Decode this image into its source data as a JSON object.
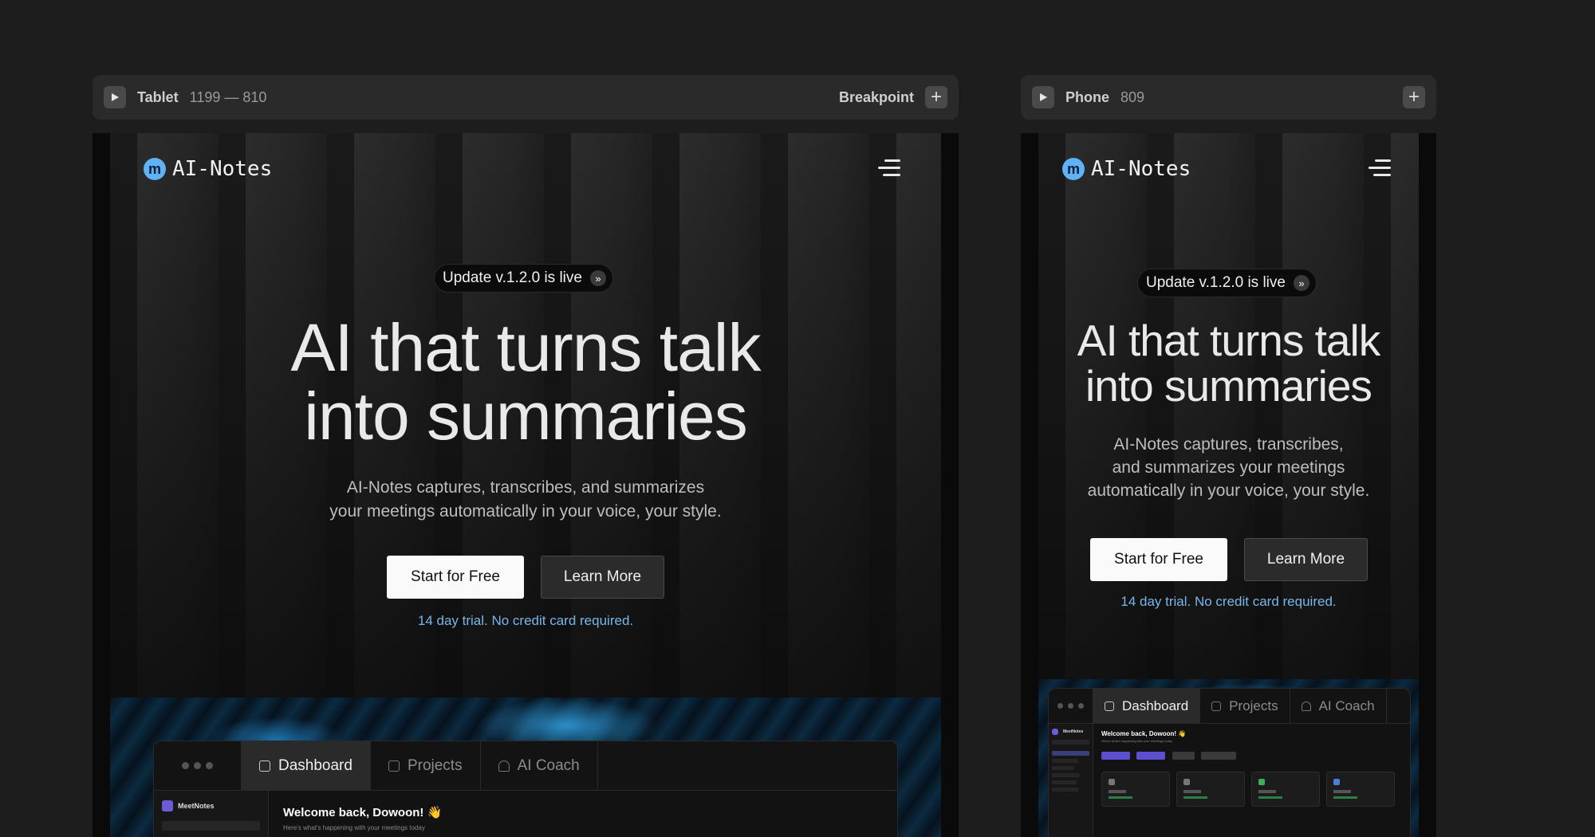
{
  "tablet_bar": {
    "name": "Tablet",
    "size": "1199 — 810",
    "breakpoint_label": "Breakpoint",
    "add_label": "+"
  },
  "phone_bar": {
    "name": "Phone",
    "size": "809",
    "add_label": "+"
  },
  "site": {
    "logo_mark": "m",
    "logo_text": "AI-Notes",
    "badge_text": "Update v.1.2.0 is live",
    "badge_chevron": "»",
    "headline_line1": "AI that turns talk",
    "headline_line2": "into summaries",
    "sub_tablet_line1": "AI-Notes captures, transcribes, and summarizes",
    "sub_tablet_line2": "your meetings automatically in your voice, your style.",
    "sub_phone_line1": "AI-Notes captures, transcribes,",
    "sub_phone_line2": "and summarizes your meetings",
    "sub_phone_line3": "automatically in your voice, your style.",
    "primary_cta": "Start for Free",
    "secondary_cta": "Learn More",
    "trial_note": "14 day trial. No credit card required."
  },
  "app_preview": {
    "tabs": [
      "Dashboard",
      "Projects",
      "AI Coach"
    ],
    "active_tab": "Dashboard",
    "side_brand": "MeetNotes",
    "welcome": "Welcome back, Dowoon! 👋",
    "welcome_sub": "Here's what's happening with your meetings today"
  },
  "colors": {
    "accent_blue": "#78b6ea",
    "logo_blue": "#5fb2f5",
    "background": "#1d1d1d"
  }
}
